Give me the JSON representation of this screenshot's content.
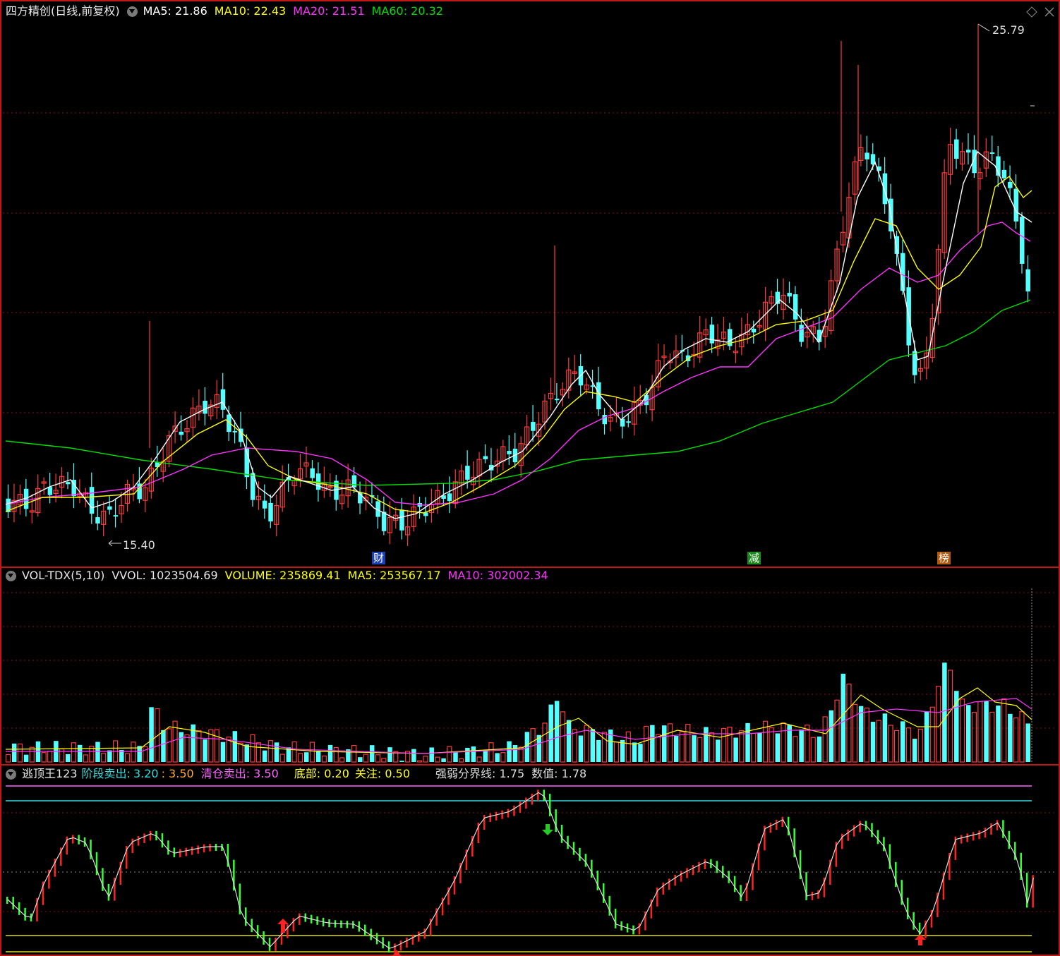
{
  "main_header": {
    "title": "四方精创(日线,前复权)",
    "ma5": "MA5: 21.86",
    "ma10": "MA10: 22.43",
    "ma20": "MA20: 21.51",
    "ma60": "MA60: 20.32"
  },
  "price_annotations": {
    "high": "25.79",
    "low": "15.40"
  },
  "event_markers": [
    "财",
    "减",
    "榜"
  ],
  "vol_header": {
    "name": "VOL-TDX(5,10)",
    "vvol": "VVOL: 1023504.69",
    "volume": "VOLUME: 235869.41",
    "ma5": "MA5: 253567.17",
    "ma10": "MA10: 302002.34"
  },
  "ind_header": {
    "name": "逃顶王123",
    "stage_sell_label": "阶段卖出:",
    "stage_sell_value": "3.20",
    "stage_sell_value2": ": 3.50",
    "clear_sell": "清仓卖出: 3.50",
    "bottom": "底部: 0.20",
    "watch": "关注: 0.50",
    "divide": "强弱分界线: 1.75",
    "value": "数值: 1.78"
  },
  "colors": {
    "up": "#ff3b3b",
    "down": "#54ffff",
    "ma5": "#ffffff",
    "ma10": "#ffff00",
    "ma20": "#ff33ff",
    "ma60": "#00e000",
    "grid": "#a01010",
    "frame": "#c01818"
  },
  "icons": [
    "dropdown-circle-icon",
    "diamond-icon",
    "close-icon"
  ]
}
